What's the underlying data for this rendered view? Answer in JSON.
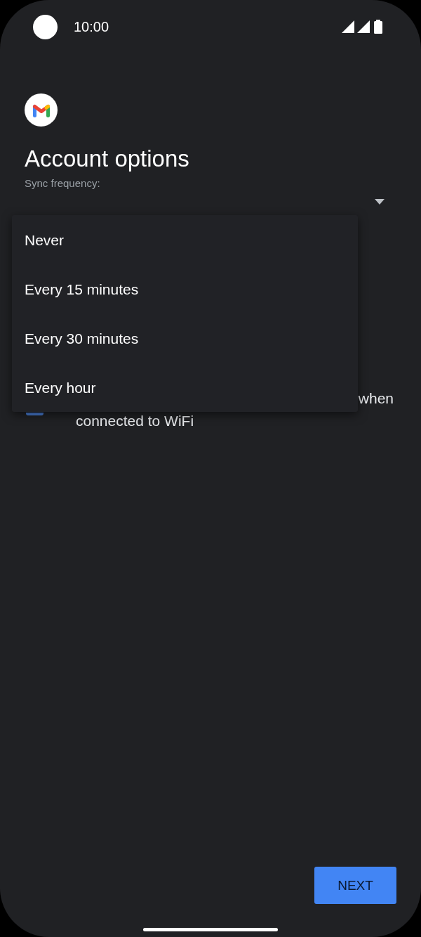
{
  "status_bar": {
    "time": "10:00"
  },
  "title": "Account options",
  "sync_frequency": {
    "label": "Sync frequency:",
    "options": [
      {
        "label": "Never",
        "selected": false
      },
      {
        "label": "Every 15 minutes",
        "selected": false
      },
      {
        "label": "Every 30 minutes",
        "selected": false
      },
      {
        "label": "Every hour",
        "selected": false
      }
    ]
  },
  "wifi_option": {
    "checked": true,
    "text_line_1": "when",
    "text_line_2": "connected to WiFi"
  },
  "buttons": [
    {
      "label": "NEXT"
    }
  ]
}
